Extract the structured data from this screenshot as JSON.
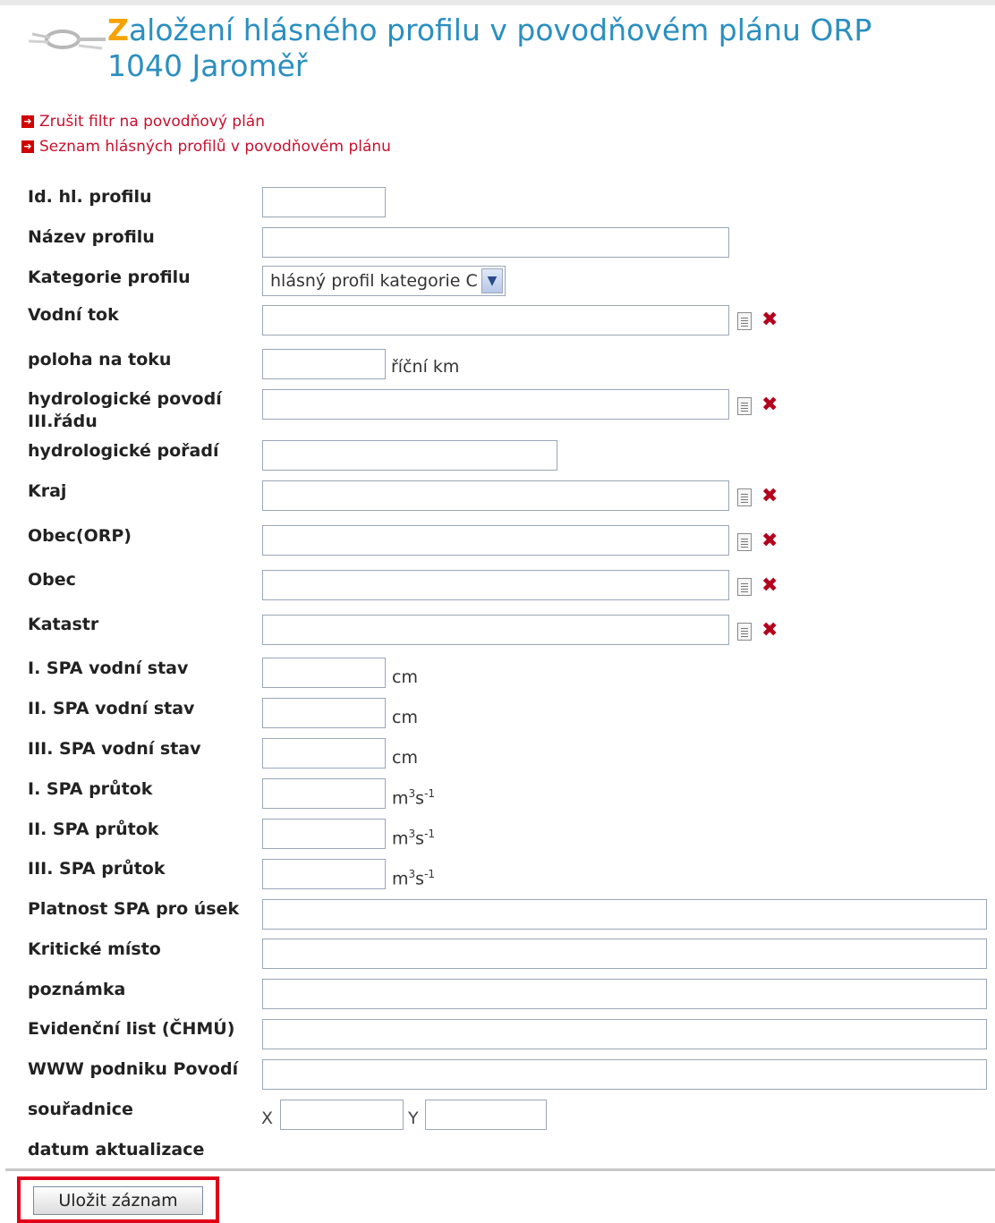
{
  "page": {
    "title_first_letter": "Z",
    "title_rest": "aložení hlásného profilu v povodňovém plánu ORP",
    "title_line2": "1040 Jaroměř"
  },
  "links": [
    {
      "label": "Zrušit filtr na povodňový plán"
    },
    {
      "label": "Seznam hlásných profilů v povodňovém plánu"
    }
  ],
  "form": {
    "id_label": "Id. hl. profilu",
    "nazev_label": "Název profilu",
    "kategorie_label": "Kategorie profilu",
    "kategorie_value": "hlásný profil kategorie C",
    "vodni_tok_label": "Vodní tok",
    "poloha_label": "poloha na toku",
    "poloha_unit": "říční km",
    "povodi_label_1": "hydrologické povodí",
    "povodi_label_2": "III.řádu",
    "poradi_label": "hydrologické pořadí",
    "kraj_label": "Kraj",
    "obec_orp_label": "Obec(ORP)",
    "obec_label": "Obec",
    "katastr_label": "Katastr",
    "spa1_stav_label": "I. SPA vodní stav",
    "spa2_stav_label": "II. SPA vodní stav",
    "spa3_stav_label": "III. SPA vodní stav",
    "stav_unit": "cm",
    "spa1_prutok_label": "I. SPA průtok",
    "spa2_prutok_label": "II. SPA průtok",
    "spa3_prutok_label": "III. SPA průtok",
    "prutok_unit_m": "m",
    "prutok_unit_3": "3",
    "prutok_unit_s": "s",
    "prutok_unit_exp": "-1",
    "platnost_label": "Platnost SPA pro úsek",
    "kriticke_label": "Kritické místo",
    "poznamka_label": "poznámka",
    "evidencni_label": "Evidenční list (ČHMÚ)",
    "www_label": "WWW podniku Povodí",
    "souradnice_label": "souřadnice",
    "x_label": "X",
    "y_label": "Y",
    "datum_label": "datum aktualizace"
  },
  "actions": {
    "save_label": "Uložit záznam"
  },
  "icons": {
    "lookup": "document-icon",
    "clear": "clear-x-icon",
    "link_arrow": "red-arrow-icon"
  },
  "colors": {
    "title": "#2b8fc0",
    "title_first": "#f5a300",
    "link": "#c8102e",
    "highlight": "#e0001a"
  }
}
